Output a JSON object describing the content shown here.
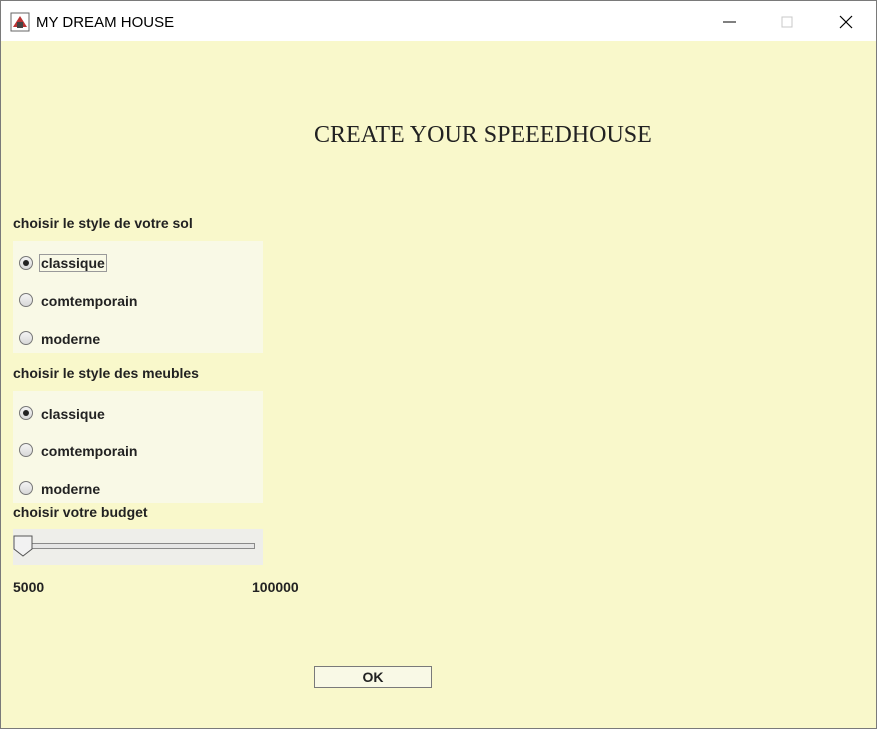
{
  "window": {
    "title": "MY DREAM HOUSE"
  },
  "main": {
    "heading": "CREATE YOUR SPEEEDHOUSE",
    "floor": {
      "label": "choisir le style de votre sol",
      "options": [
        "classique",
        "comtemporain",
        "moderne"
      ],
      "selected": "classique"
    },
    "furniture": {
      "label": "choisir le style des meubles",
      "options": [
        "classique",
        "comtemporain",
        "moderne"
      ],
      "selected": "classique"
    },
    "budget": {
      "label": "choisir votre budget",
      "min_label": "5000",
      "max_label": "100000",
      "value": 5000
    },
    "ok_label": "OK"
  },
  "colors": {
    "background": "#f9f8cb",
    "panel": "#f9f9e6",
    "slider_panel": "#eeeeea"
  }
}
